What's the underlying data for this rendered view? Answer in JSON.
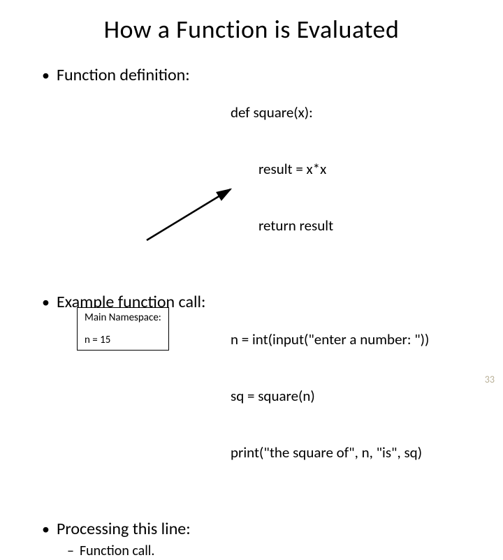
{
  "title": "How a Function is Evaluated",
  "bullets": {
    "definition": "Function definition:",
    "example": "Example function call:",
    "processing": "Processing this line:"
  },
  "sub_bullet": "Function call.",
  "code": {
    "def_line1": "def square(x):",
    "def_line2": "result = x*x",
    "def_line3": "return result",
    "call_line1": "n = int(input(\"enter a number: \"))",
    "call_line2": "sq = square(n)",
    "call_line3": "print(\"the square of\", n, \"is\", sq)"
  },
  "namespace": {
    "header": "Main Namespace:",
    "value": "n = 15"
  },
  "page_number": "33"
}
